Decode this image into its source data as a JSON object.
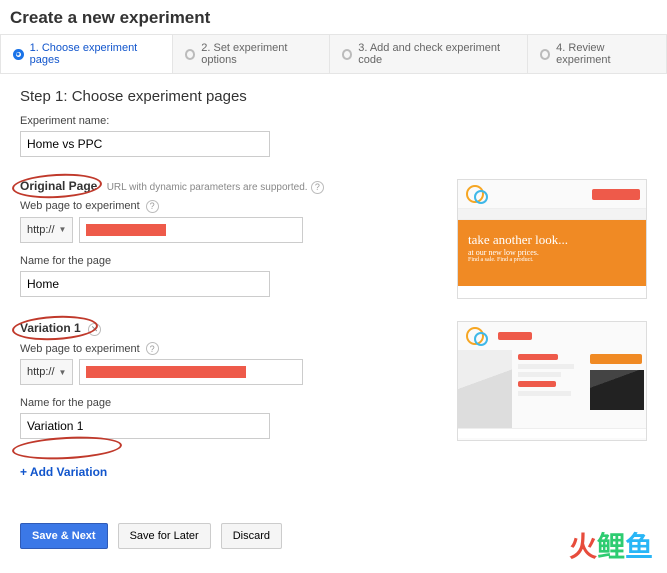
{
  "header": {
    "title": "Create a new experiment"
  },
  "steps": [
    {
      "label": "1. Choose experiment pages"
    },
    {
      "label": "2. Set experiment options"
    },
    {
      "label": "3. Add and check experiment code"
    },
    {
      "label": "4. Review experiment"
    }
  ],
  "step_title": "Step 1: Choose experiment pages",
  "name_field": {
    "label": "Experiment name:",
    "value": "Home vs PPC"
  },
  "original": {
    "heading": "Original Page",
    "note": "URL with dynamic parameters are supported.",
    "web_label": "Web page to experiment",
    "proto": "http://",
    "name_label": "Name for the page",
    "name_value": "Home",
    "preview": {
      "hero_line1": "take another look...",
      "hero_line2": "at our new low prices.",
      "hero_line3": "Find a sale. Find a product."
    }
  },
  "variation": {
    "heading": "Variation 1",
    "web_label": "Web page to experiment",
    "proto": "http://",
    "name_label": "Name for the page",
    "name_value": "Variation 1"
  },
  "add_variation": "+ Add Variation",
  "buttons": {
    "save_next": "Save & Next",
    "save_later": "Save for Later",
    "discard": "Discard"
  },
  "watermark": "火鲤鱼"
}
